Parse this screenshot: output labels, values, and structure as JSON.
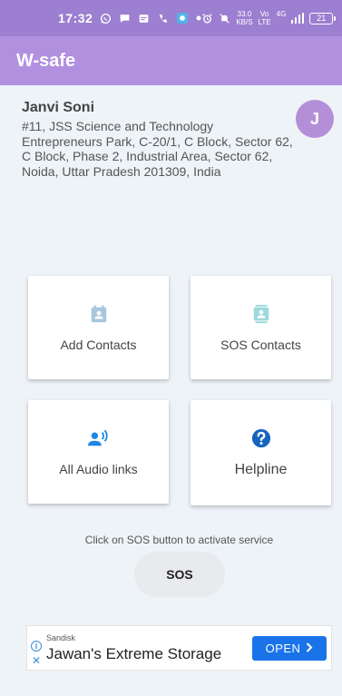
{
  "status_bar": {
    "time": "17:32",
    "net_speed_value": "33.0",
    "net_speed_unit": "KB/S",
    "volte_top": "Vo",
    "volte_bottom": "LTE",
    "network": "4G",
    "battery": "21"
  },
  "app_bar": {
    "title": "W-safe"
  },
  "user": {
    "name": "Janvi Soni",
    "address": "#11, JSS Science and Technology Entrepreneurs Park, C-20/1, C Block, Sector 62, C Block, Phase 2, Industrial Area, Sector 62, Noida, Uttar Pradesh 201309, India",
    "avatar_initial": "J"
  },
  "cards": {
    "add_contacts": {
      "label": "Add Contacts",
      "icon": "calendar-contact-icon",
      "color": "#a8c7dc"
    },
    "sos_contacts": {
      "label": "SOS Contacts",
      "icon": "contacts-book-icon",
      "color": "#9ed9dc"
    },
    "audio_links": {
      "label": "All Audio links",
      "icon": "voice-person-icon",
      "color": "#1e88e5"
    },
    "helpline": {
      "label": "Helpline",
      "icon": "help-circle-icon",
      "color": "#1565c0"
    }
  },
  "sos": {
    "hint": "Click on SOS button to activate service",
    "button_label": "SOS"
  },
  "ad": {
    "sponsor": "Sandisk",
    "headline": "Jawan's Extreme Storage",
    "cta": "OPEN",
    "cta_color": "#1a73e8"
  },
  "colors": {
    "status_bar": "#9c7fd0",
    "app_bar": "#b090df",
    "background": "#eef3f8",
    "avatar": "#b48fd8"
  }
}
